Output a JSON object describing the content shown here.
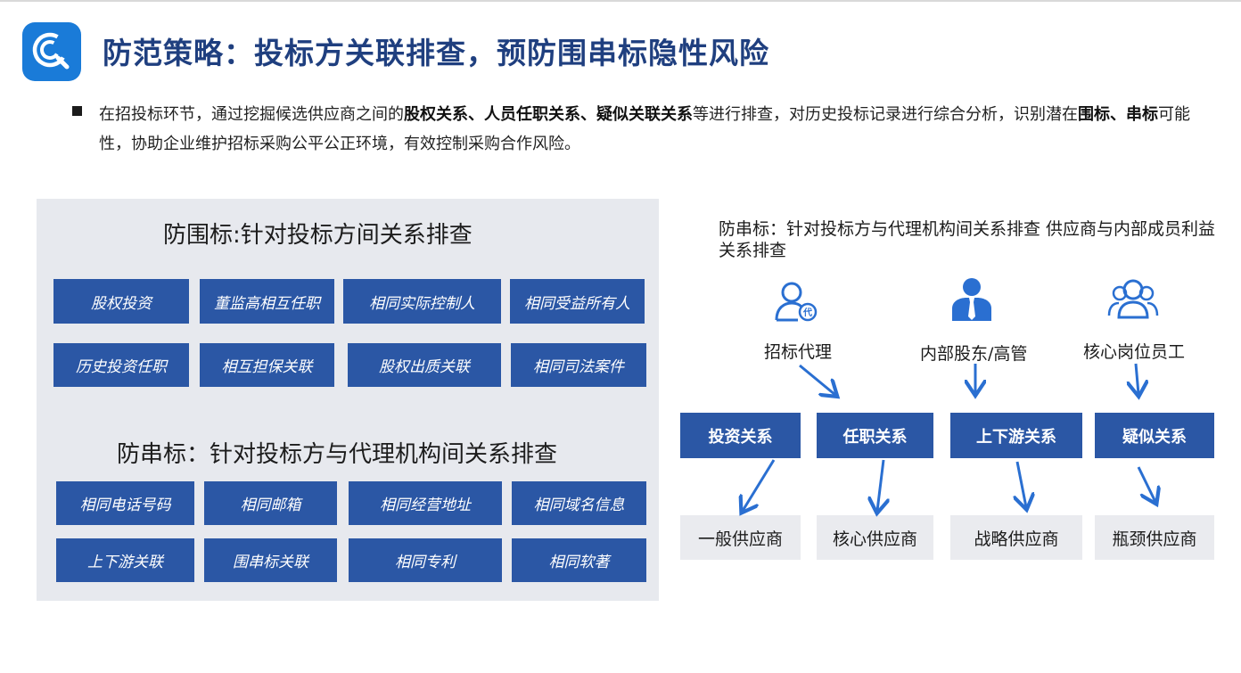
{
  "header": {
    "logo_icon": "search-logo-icon",
    "title": "防范策略：投标方关联排查，预防围串标隐性风险",
    "accent": "#1a7bd8"
  },
  "intro": {
    "p1": "在招投标环节，通过挖掘候选供应商之间的",
    "b1": "股权关系、人员任职关系、疑似关联关系",
    "p2": "等进行排查，对历史投标记录进行综合分析，识别潜在",
    "b2": "围标",
    "p3": "、",
    "b3": "串标",
    "p4": "可能性，协助企业维护招标采购公平公正环境，有效控制采购合作风险。"
  },
  "weibiao": {
    "title": "防围标:针对投标方间关系排查",
    "items": [
      "股权投资",
      "董监高相互任职",
      "相同实际控制人",
      "相同受益所有人",
      "历史投资任职",
      "相互担保关联",
      "股权出质关联",
      "相同司法案件"
    ]
  },
  "chuanbiao": {
    "title": "防串标：针对投标方与代理机构间关系排查",
    "items": [
      "相同电话号码",
      "相同邮箱",
      "相同经营地址",
      "相同域名信息",
      "上下游关联",
      "围串标关联",
      "相同专利",
      "相同软著"
    ]
  },
  "right": {
    "heading": "防串标：针对投标方与代理机构间关系排查 供应商与内部成员利益关系排查",
    "roles": [
      {
        "label": "招标代理",
        "icon": "agent-person-icon"
      },
      {
        "label": "内部股东/高管",
        "icon": "executive-person-icon"
      },
      {
        "label": "核心岗位员工",
        "icon": "employee-group-icon"
      }
    ],
    "relations": [
      "投资关系",
      "任职关系",
      "上下游关系",
      "疑似关系"
    ],
    "suppliers": [
      "一般供应商",
      "核心供应商",
      "战略供应商",
      "瓶颈供应商"
    ],
    "colors": {
      "box": "#2b57a5",
      "arrow": "#2a6fd1"
    }
  }
}
